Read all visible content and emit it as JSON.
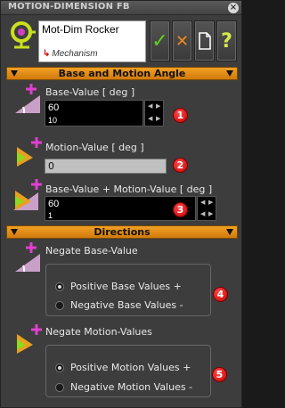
{
  "window": {
    "title": "MOTION-DIMENSION FB",
    "close_glyph": "×"
  },
  "header": {
    "name": "Mot-Dim Rocker",
    "mechanism": "Mechanism",
    "buttons": [
      {
        "name": "ok",
        "glyph": "✓",
        "color": "#5fd11e"
      },
      {
        "name": "cancel",
        "glyph": "✕",
        "color": "#f08a1a"
      },
      {
        "name": "new",
        "glyph": "",
        "color": "#ffffff"
      },
      {
        "name": "help",
        "glyph": "?",
        "color": "#d7e84a"
      }
    ]
  },
  "sections": {
    "base_motion": "Base and Motion Angle",
    "directions": "Directions"
  },
  "base_value": {
    "label": "Base-Value [ deg ]",
    "value": "60",
    "step": "10",
    "badge": "1"
  },
  "motion_value": {
    "label": "Motion-Value [ deg ]",
    "value": "0",
    "badge": "2"
  },
  "sum_value": {
    "label": "Base-Value + Motion-Value [ deg ]",
    "value": "60",
    "step": "1",
    "badge": "3"
  },
  "negate_base": {
    "label": "Negate Base-Value",
    "badge": "4",
    "options": [
      {
        "label": "Positive Base Values +",
        "selected": true
      },
      {
        "label": "Negative Base Values -",
        "selected": false
      }
    ]
  },
  "negate_motion": {
    "label": "Negate Motion-Values",
    "badge": "5",
    "options": [
      {
        "label": "Positive Motion Values +",
        "selected": true
      },
      {
        "label": "Negative Motion Values -",
        "selected": false
      }
    ]
  },
  "colors": {
    "accent": "#e6901a",
    "badge": "#d40000",
    "plus": "#e040d0"
  }
}
